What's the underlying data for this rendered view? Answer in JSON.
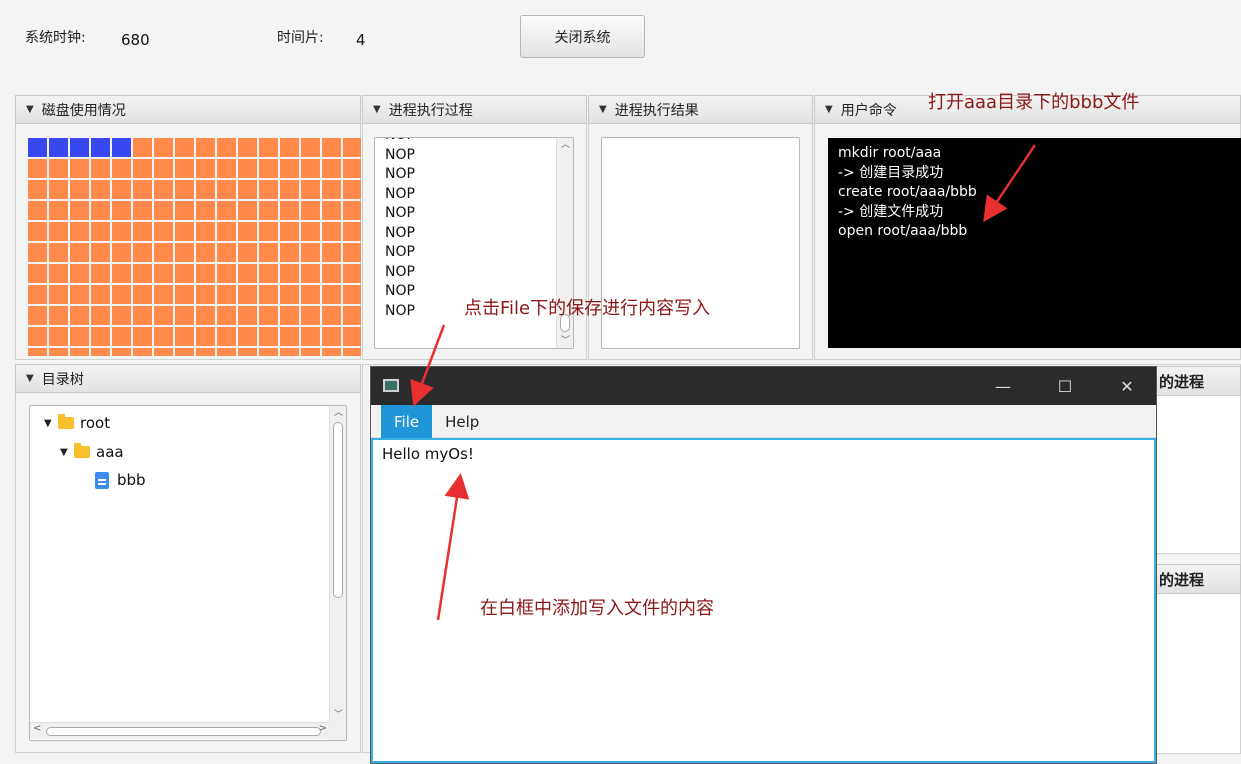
{
  "topbar": {
    "clock_label": "系统时钟:",
    "clock_value": "680",
    "slice_label": "时间片:",
    "slice_value": "4",
    "close_button": "关闭系统"
  },
  "panes": {
    "disk": "磁盘使用情况",
    "process_exec": "进程执行过程",
    "process_result": "进程执行结果",
    "user_command": "用户命令",
    "dir_tree": "目录树",
    "right_partial_1": "的进程",
    "right_partial_2": "的进程"
  },
  "disk_usage": {
    "used_blocks": 5
  },
  "process_exec_lines": [
    "NOP",
    "NOP",
    "NOP",
    "NOP",
    "NOP",
    "NOP",
    "NOP",
    "NOP",
    "NOP",
    "NOP"
  ],
  "terminal_lines": [
    "mkdir root/aaa",
    "-> 创建目录成功",
    "create root/aaa/bbb",
    "-> 创建文件成功",
    "open root/aaa/bbb"
  ],
  "tree": {
    "root": "root",
    "folder": "aaa",
    "file": "bbb"
  },
  "editor": {
    "menu_file": "File",
    "menu_help": "Help",
    "content": "Hello myOs!",
    "min_glyph": "—",
    "max_glyph": "☐",
    "close_glyph": "✕"
  },
  "annotations": {
    "open_file": "打开aaa目录下的bbb文件",
    "save_hint": "点击File下的保存进行内容写入",
    "add_content": "在白框中添加写入文件的内容"
  },
  "colors": {
    "disk_used": "#3848f0",
    "disk_free": "#ff8a4c",
    "annotation": "#8b1717",
    "menu_active": "#1e96d8"
  }
}
